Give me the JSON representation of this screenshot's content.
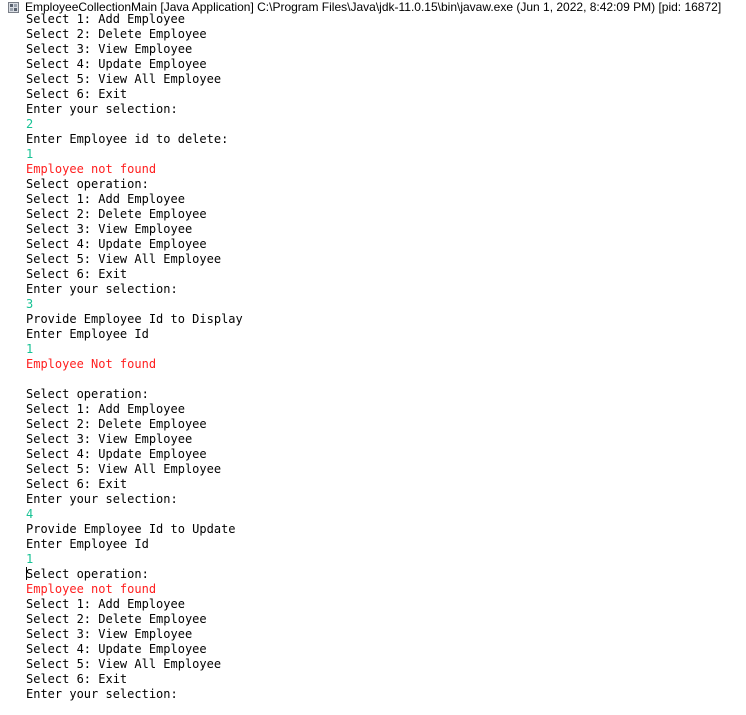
{
  "console": {
    "title": "EmployeeCollectionMain [Java Application] C:\\Program Files\\Java\\jdk-11.0.15\\bin\\javaw.exe  (Jun 1, 2022, 8:42:09 PM) [pid: 16872]",
    "icon": "terminated-console-icon",
    "colors": {
      "stdout": "#000000",
      "stdin": "#17c294",
      "stderr": "#ff1e1e"
    },
    "lines": [
      {
        "kind": "out",
        "text": "Select 1: Add Employee"
      },
      {
        "kind": "out",
        "text": "Select 2: Delete Employee"
      },
      {
        "kind": "out",
        "text": "Select 3: View Employee"
      },
      {
        "kind": "out",
        "text": "Select 4: Update Employee"
      },
      {
        "kind": "out",
        "text": "Select 5: View All Employee"
      },
      {
        "kind": "out",
        "text": "Select 6: Exit"
      },
      {
        "kind": "out",
        "text": "Enter your selection:"
      },
      {
        "kind": "in",
        "text": "2"
      },
      {
        "kind": "out",
        "text": "Enter Employee id to delete:"
      },
      {
        "kind": "in",
        "text": "1"
      },
      {
        "kind": "err",
        "text": "Employee not found"
      },
      {
        "kind": "out",
        "text": "Select operation:"
      },
      {
        "kind": "out",
        "text": "Select 1: Add Employee"
      },
      {
        "kind": "out",
        "text": "Select 2: Delete Employee"
      },
      {
        "kind": "out",
        "text": "Select 3: View Employee"
      },
      {
        "kind": "out",
        "text": "Select 4: Update Employee"
      },
      {
        "kind": "out",
        "text": "Select 5: View All Employee"
      },
      {
        "kind": "out",
        "text": "Select 6: Exit"
      },
      {
        "kind": "out",
        "text": "Enter your selection:"
      },
      {
        "kind": "in",
        "text": "3"
      },
      {
        "kind": "out",
        "text": "Provide Employee Id to Display"
      },
      {
        "kind": "out",
        "text": "Enter Employee Id"
      },
      {
        "kind": "in",
        "text": "1"
      },
      {
        "kind": "err",
        "text": "Employee Not found"
      },
      {
        "kind": "out",
        "text": ""
      },
      {
        "kind": "out",
        "text": "Select operation:"
      },
      {
        "kind": "out",
        "text": "Select 1: Add Employee"
      },
      {
        "kind": "out",
        "text": "Select 2: Delete Employee"
      },
      {
        "kind": "out",
        "text": "Select 3: View Employee"
      },
      {
        "kind": "out",
        "text": "Select 4: Update Employee"
      },
      {
        "kind": "out",
        "text": "Select 5: View All Employee"
      },
      {
        "kind": "out",
        "text": "Select 6: Exit"
      },
      {
        "kind": "out",
        "text": "Enter your selection:"
      },
      {
        "kind": "in",
        "text": "4"
      },
      {
        "kind": "out",
        "text": "Provide Employee Id to Update"
      },
      {
        "kind": "out",
        "text": "Enter Employee Id"
      },
      {
        "kind": "in",
        "text": "1"
      },
      {
        "kind": "out",
        "text": "Select operation:",
        "caret": true
      },
      {
        "kind": "err",
        "text": "Employee not found"
      },
      {
        "kind": "out",
        "text": "Select 1: Add Employee"
      },
      {
        "kind": "out",
        "text": "Select 2: Delete Employee"
      },
      {
        "kind": "out",
        "text": "Select 3: View Employee"
      },
      {
        "kind": "out",
        "text": "Select 4: Update Employee"
      },
      {
        "kind": "out",
        "text": "Select 5: View All Employee"
      },
      {
        "kind": "out",
        "text": "Select 6: Exit"
      },
      {
        "kind": "out",
        "text": "Enter your selection:"
      }
    ]
  }
}
